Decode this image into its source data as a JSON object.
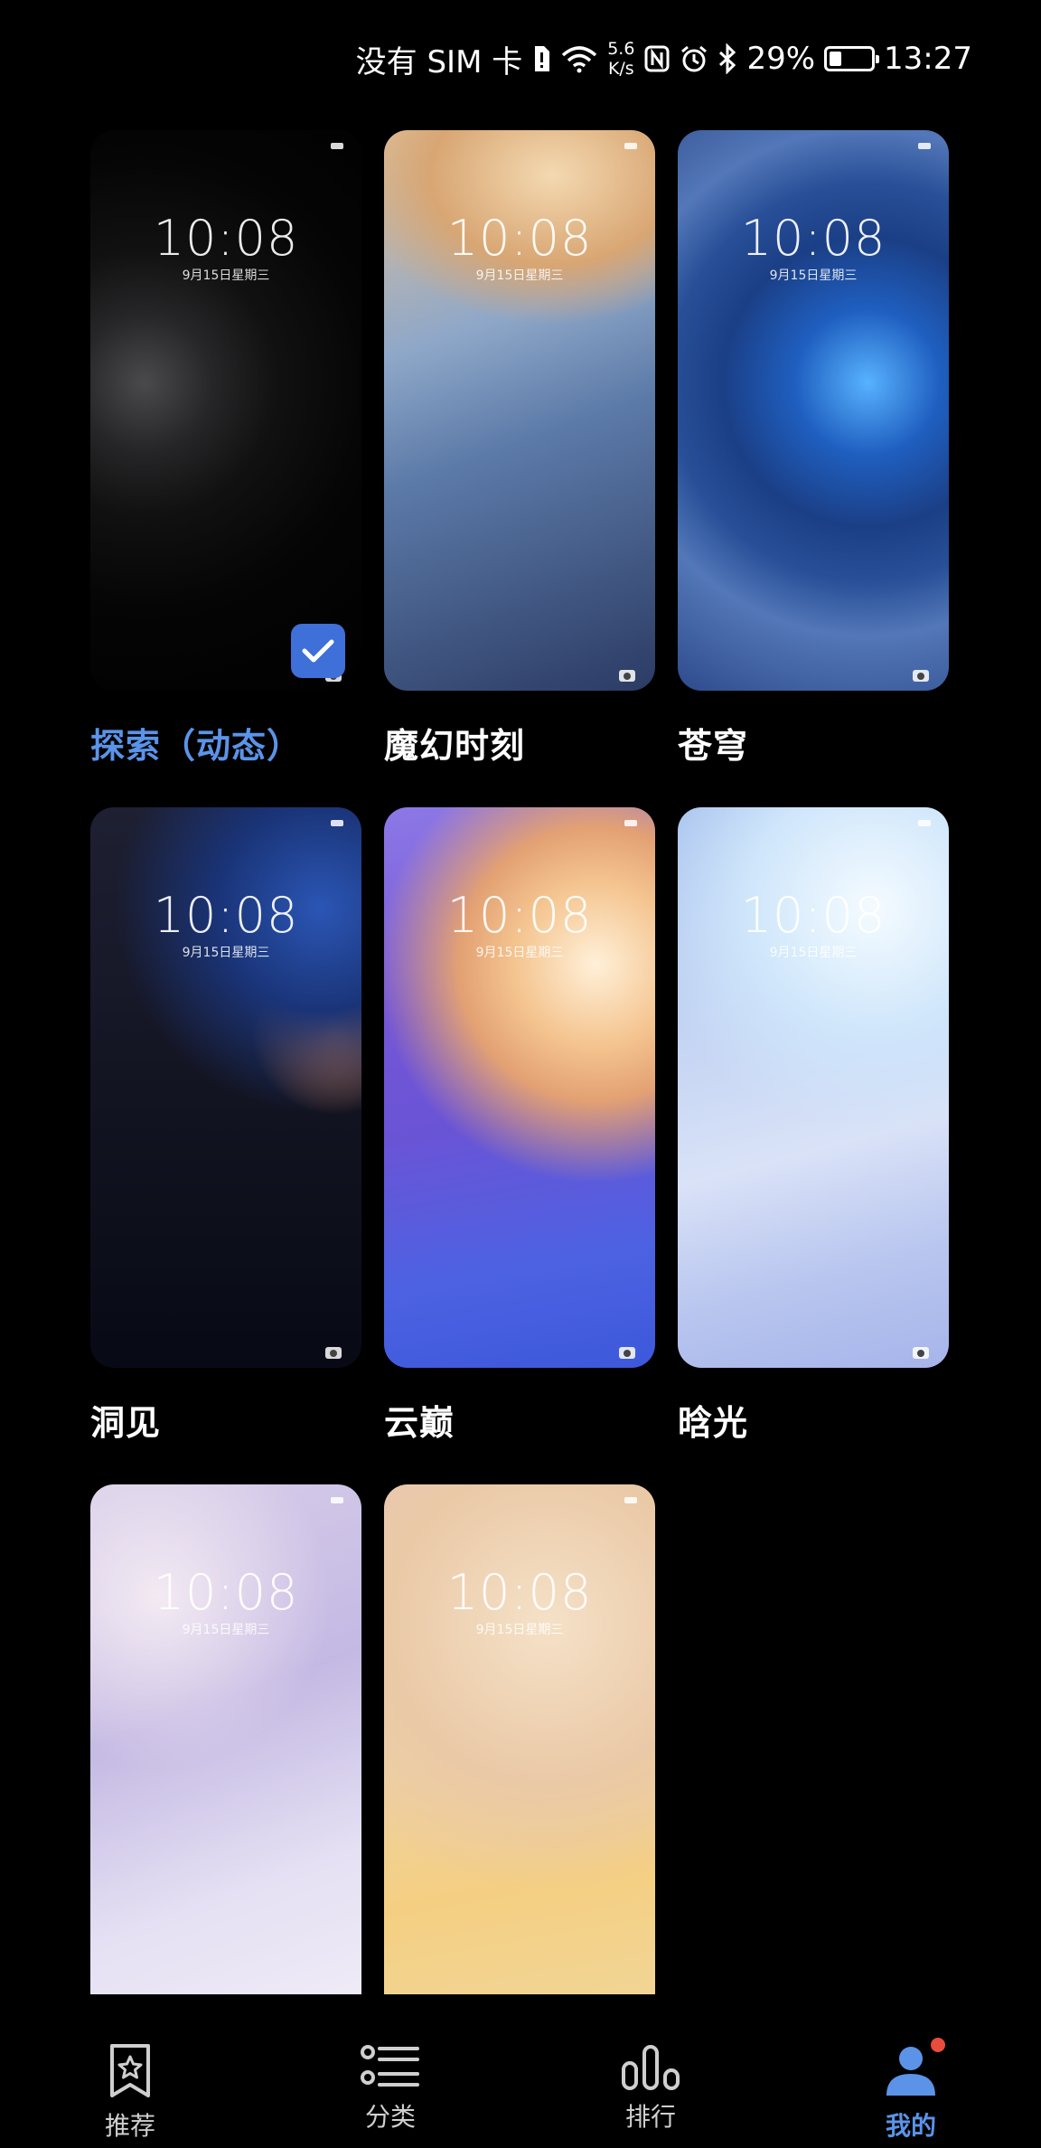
{
  "status_bar": {
    "sim": "没有 SIM 卡",
    "speed_value": "5.6",
    "speed_unit": "K/s",
    "battery_level": 0.29,
    "battery": "29%",
    "time": "13:27"
  },
  "wallpapers": [
    {
      "name": "探索（动态）",
      "clock": "10:08",
      "date": "9月15日星期三",
      "selected": true
    },
    {
      "name": "魔幻时刻",
      "clock": "10:08",
      "date": "9月15日星期三",
      "selected": false
    },
    {
      "name": "苍穹",
      "clock": "10:08",
      "date": "9月15日星期三",
      "selected": false
    },
    {
      "name": "洞见",
      "clock": "10:08",
      "date": "9月15日星期三",
      "selected": false
    },
    {
      "name": "云巅",
      "clock": "10:08",
      "date": "9月15日星期三",
      "selected": false
    },
    {
      "name": "晗光",
      "clock": "10:08",
      "date": "9月15日星期三",
      "selected": false
    },
    {
      "name": "",
      "clock": "10:08",
      "date": "9月15日星期三",
      "selected": false
    },
    {
      "name": "",
      "clock": "10:08",
      "date": "9月15日星期三",
      "selected": false
    }
  ],
  "nav": {
    "items": [
      {
        "label": "推荐",
        "icon": "bookmark-star-icon"
      },
      {
        "label": "分类",
        "icon": "list-icon"
      },
      {
        "label": "排行",
        "icon": "bar-chart-icon"
      },
      {
        "label": "我的",
        "icon": "person-icon"
      }
    ],
    "active_index": 3,
    "accent": "#5b93e8"
  }
}
